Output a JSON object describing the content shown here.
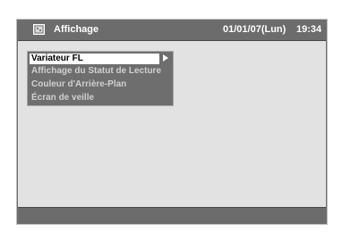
{
  "header": {
    "icon": "display-settings-icon",
    "title": "Affichage",
    "date": "01/01/07(Lun)",
    "time": "19:34"
  },
  "menu": {
    "items": [
      {
        "label": "Variateur FL",
        "selected": true
      },
      {
        "label": "Affichage du Statut de Lecture",
        "selected": false
      },
      {
        "label": "Couleur d'Arrière-Plan",
        "selected": false
      },
      {
        "label": "Écran de veille",
        "selected": false
      }
    ],
    "submenu_indicator": "right-arrow-icon"
  },
  "colors": {
    "header_bar": "#6c6c6c",
    "panel_background": "#e2e2e2",
    "menu_background": "#6e6e6e",
    "selection_highlight": "#ffffff"
  }
}
